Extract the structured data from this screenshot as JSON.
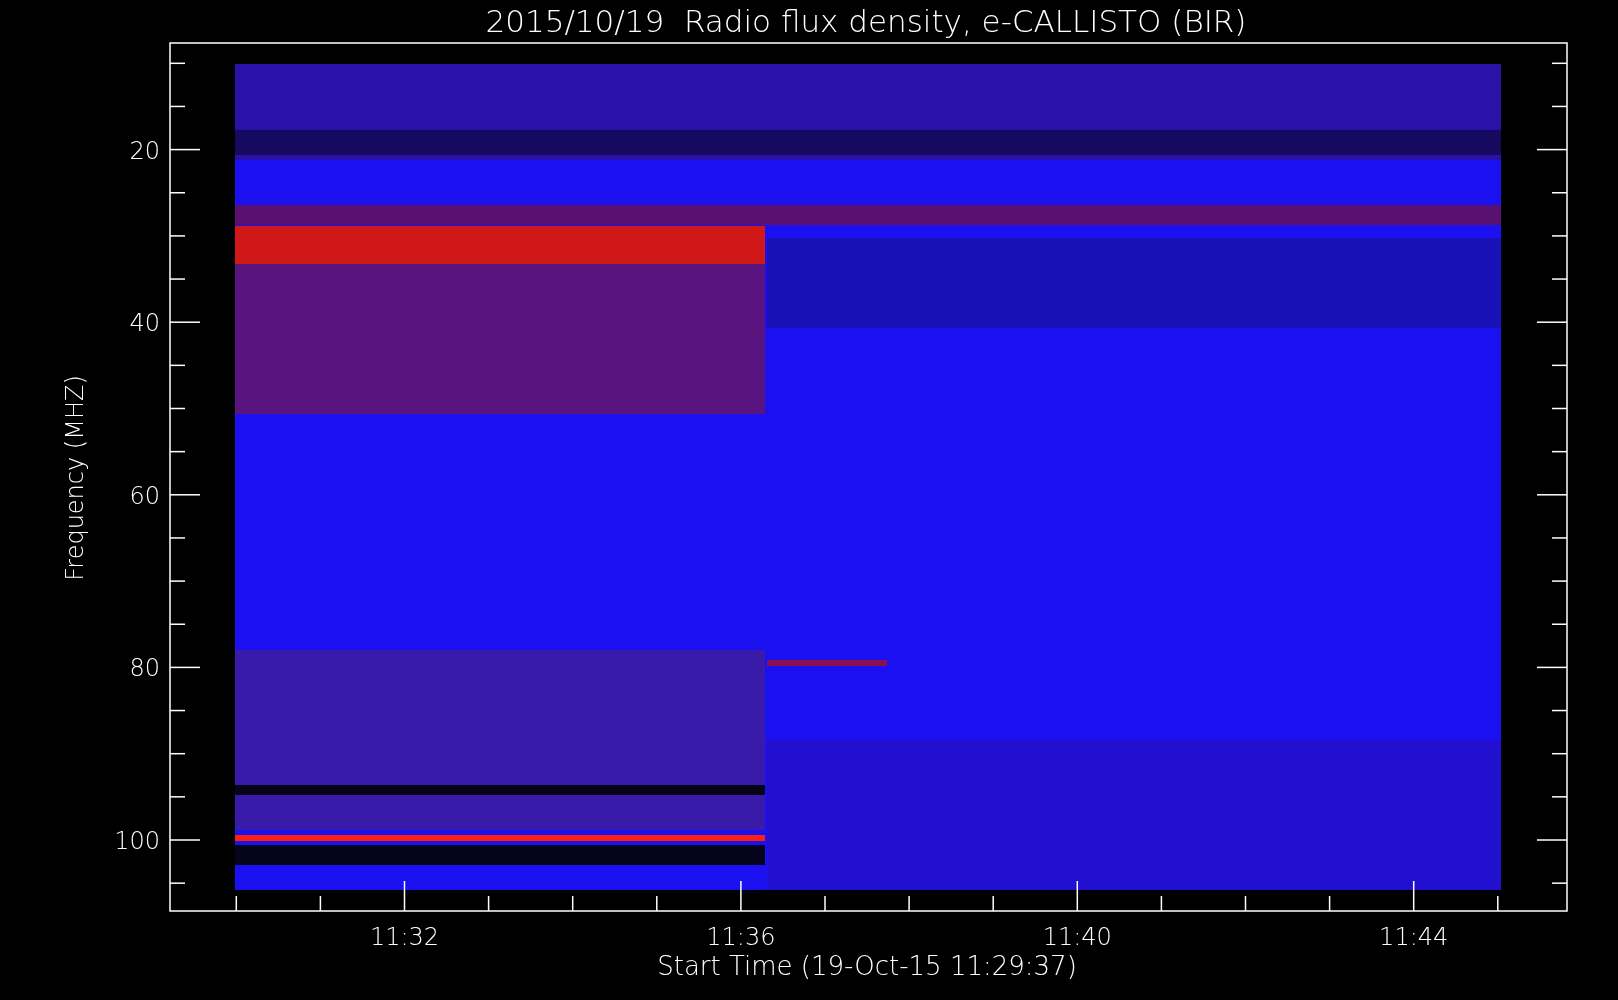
{
  "title": "2015/10/19  Radio flux density, e-CALLISTO (BIR)",
  "y_axis": {
    "label": "Frequency (MHZ)",
    "ticks": [
      "20",
      "40",
      "60",
      "80",
      "100"
    ]
  },
  "x_axis": {
    "label": "Start Time (19-Oct-15 11:29:37)",
    "ticks": [
      "11:32",
      "11:36",
      "11:40",
      "11:44"
    ]
  }
}
